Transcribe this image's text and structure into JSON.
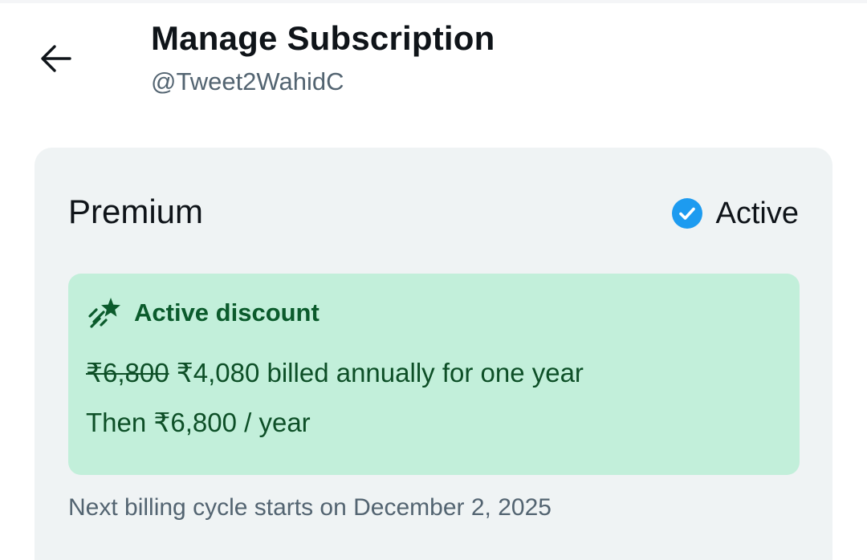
{
  "header": {
    "title": "Manage Subscription",
    "handle": "@Tweet2WahidC",
    "back_icon": "arrow-left-icon"
  },
  "subscription": {
    "plan_name": "Premium",
    "status_label": "Active",
    "status_icon": "check-circle-icon",
    "status_color": "#1d9bf0",
    "discount": {
      "icon": "sparkle-star-icon",
      "title": "Active discount",
      "old_price": "₹6,800",
      "new_price_text": "₹4,080 billed annually for one year",
      "then_text": "Then ₹6,800 / year",
      "background_color": "#c2efda",
      "text_color": "#0b5b2c"
    },
    "billing_note": "Next billing cycle starts on December 2, 2025"
  }
}
